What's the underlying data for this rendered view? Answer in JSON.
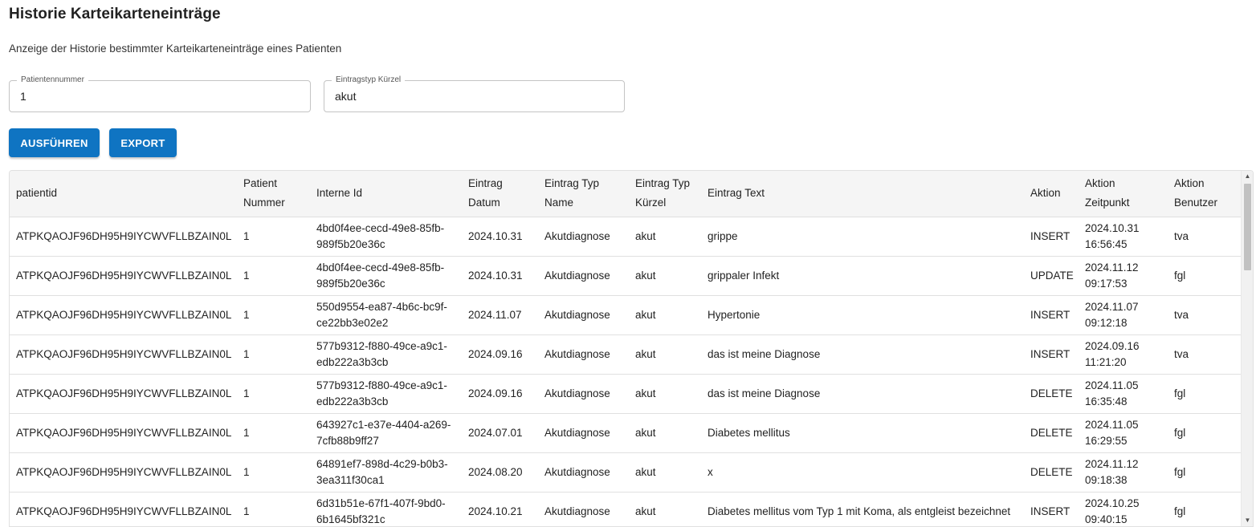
{
  "header": {
    "title": "Historie Karteikarteneinträge",
    "subtitle": "Anzeige der Historie bestimmter Karteikarteneinträge eines Patienten"
  },
  "form": {
    "patient_number": {
      "label": "Patientennummer",
      "value": "1"
    },
    "entry_type": {
      "label": "Eintragstyp Kürzel",
      "value": "akut"
    }
  },
  "toolbar": {
    "run_label": "AUSFÜHREN",
    "export_label": "EXPORT"
  },
  "colors": {
    "primary": "#0f74c2",
    "header_bg": "#f5f5f5",
    "border": "#e0e0e0"
  },
  "table": {
    "columns": [
      {
        "key": "patientid",
        "line1": "patientid",
        "line2": ""
      },
      {
        "key": "patient_nummer",
        "line1": "Patient",
        "line2": "Nummer"
      },
      {
        "key": "interne_id",
        "line1": "Interne Id",
        "line2": ""
      },
      {
        "key": "eintrag_datum",
        "line1": "Eintrag",
        "line2": "Datum"
      },
      {
        "key": "eintrag_typ_name",
        "line1": "Eintrag Typ",
        "line2": "Name"
      },
      {
        "key": "eintrag_typ_kuerzel",
        "line1": "Eintrag Typ",
        "line2": "Kürzel"
      },
      {
        "key": "eintrag_text",
        "line1": "Eintrag Text",
        "line2": ""
      },
      {
        "key": "aktion",
        "line1": "Aktion",
        "line2": ""
      },
      {
        "key": "aktion_zeitpunkt",
        "line1": "Aktion",
        "line2": "Zeitpunkt"
      },
      {
        "key": "aktion_benutzer",
        "line1": "Aktion",
        "line2": "Benutzer"
      }
    ],
    "rows": [
      {
        "patientid": "ATPKQAOJF96DH95H9IYCWVFLLBZAIN0L",
        "patient_nummer": "1",
        "interne_id": "4bd0f4ee-cecd-49e8-85fb-989f5b20e36c",
        "eintrag_datum": "2024.10.31",
        "eintrag_typ_name": "Akutdiagnose",
        "eintrag_typ_kuerzel": "akut",
        "eintrag_text": "grippe",
        "aktion": "INSERT",
        "aktion_zeitpunkt": "2024.10.31 16:56:45",
        "aktion_benutzer": "tva"
      },
      {
        "patientid": "ATPKQAOJF96DH95H9IYCWVFLLBZAIN0L",
        "patient_nummer": "1",
        "interne_id": "4bd0f4ee-cecd-49e8-85fb-989f5b20e36c",
        "eintrag_datum": "2024.10.31",
        "eintrag_typ_name": "Akutdiagnose",
        "eintrag_typ_kuerzel": "akut",
        "eintrag_text": "grippaler Infekt",
        "aktion": "UPDATE",
        "aktion_zeitpunkt": "2024.11.12 09:17:53",
        "aktion_benutzer": "fgl"
      },
      {
        "patientid": "ATPKQAOJF96DH95H9IYCWVFLLBZAIN0L",
        "patient_nummer": "1",
        "interne_id": "550d9554-ea87-4b6c-bc9f-ce22bb3e02e2",
        "eintrag_datum": "2024.11.07",
        "eintrag_typ_name": "Akutdiagnose",
        "eintrag_typ_kuerzel": "akut",
        "eintrag_text": "Hypertonie",
        "aktion": "INSERT",
        "aktion_zeitpunkt": "2024.11.07 09:12:18",
        "aktion_benutzer": "tva"
      },
      {
        "patientid": "ATPKQAOJF96DH95H9IYCWVFLLBZAIN0L",
        "patient_nummer": "1",
        "interne_id": "577b9312-f880-49ce-a9c1-edb222a3b3cb",
        "eintrag_datum": "2024.09.16",
        "eintrag_typ_name": "Akutdiagnose",
        "eintrag_typ_kuerzel": "akut",
        "eintrag_text": "das ist meine Diagnose",
        "aktion": "INSERT",
        "aktion_zeitpunkt": "2024.09.16 11:21:20",
        "aktion_benutzer": "tva"
      },
      {
        "patientid": "ATPKQAOJF96DH95H9IYCWVFLLBZAIN0L",
        "patient_nummer": "1",
        "interne_id": "577b9312-f880-49ce-a9c1-edb222a3b3cb",
        "eintrag_datum": "2024.09.16",
        "eintrag_typ_name": "Akutdiagnose",
        "eintrag_typ_kuerzel": "akut",
        "eintrag_text": "das ist meine Diagnose",
        "aktion": "DELETE",
        "aktion_zeitpunkt": "2024.11.05 16:35:48",
        "aktion_benutzer": "fgl"
      },
      {
        "patientid": "ATPKQAOJF96DH95H9IYCWVFLLBZAIN0L",
        "patient_nummer": "1",
        "interne_id": "643927c1-e37e-4404-a269-7cfb88b9ff27",
        "eintrag_datum": "2024.07.01",
        "eintrag_typ_name": "Akutdiagnose",
        "eintrag_typ_kuerzel": "akut",
        "eintrag_text": "Diabetes mellitus",
        "aktion": "DELETE",
        "aktion_zeitpunkt": "2024.11.05 16:29:55",
        "aktion_benutzer": "fgl"
      },
      {
        "patientid": "ATPKQAOJF96DH95H9IYCWVFLLBZAIN0L",
        "patient_nummer": "1",
        "interne_id": "64891ef7-898d-4c29-b0b3-3ea311f30ca1",
        "eintrag_datum": "2024.08.20",
        "eintrag_typ_name": "Akutdiagnose",
        "eintrag_typ_kuerzel": "akut",
        "eintrag_text": "x",
        "aktion": "DELETE",
        "aktion_zeitpunkt": "2024.11.12 09:18:38",
        "aktion_benutzer": "fgl"
      },
      {
        "patientid": "ATPKQAOJF96DH95H9IYCWVFLLBZAIN0L",
        "patient_nummer": "1",
        "interne_id": "6d31b51e-67f1-407f-9bd0-6b1645bf321c",
        "eintrag_datum": "2024.10.21",
        "eintrag_typ_name": "Akutdiagnose",
        "eintrag_typ_kuerzel": "akut",
        "eintrag_text": "Diabetes mellitus vom Typ 1 mit Koma, als entgleist bezeichnet",
        "aktion": "INSERT",
        "aktion_zeitpunkt": "2024.10.25 09:40:15",
        "aktion_benutzer": "fgl"
      }
    ]
  },
  "scrollbar": {
    "up_icon": "arrow-up-icon",
    "down_icon": "arrow-down-icon"
  }
}
